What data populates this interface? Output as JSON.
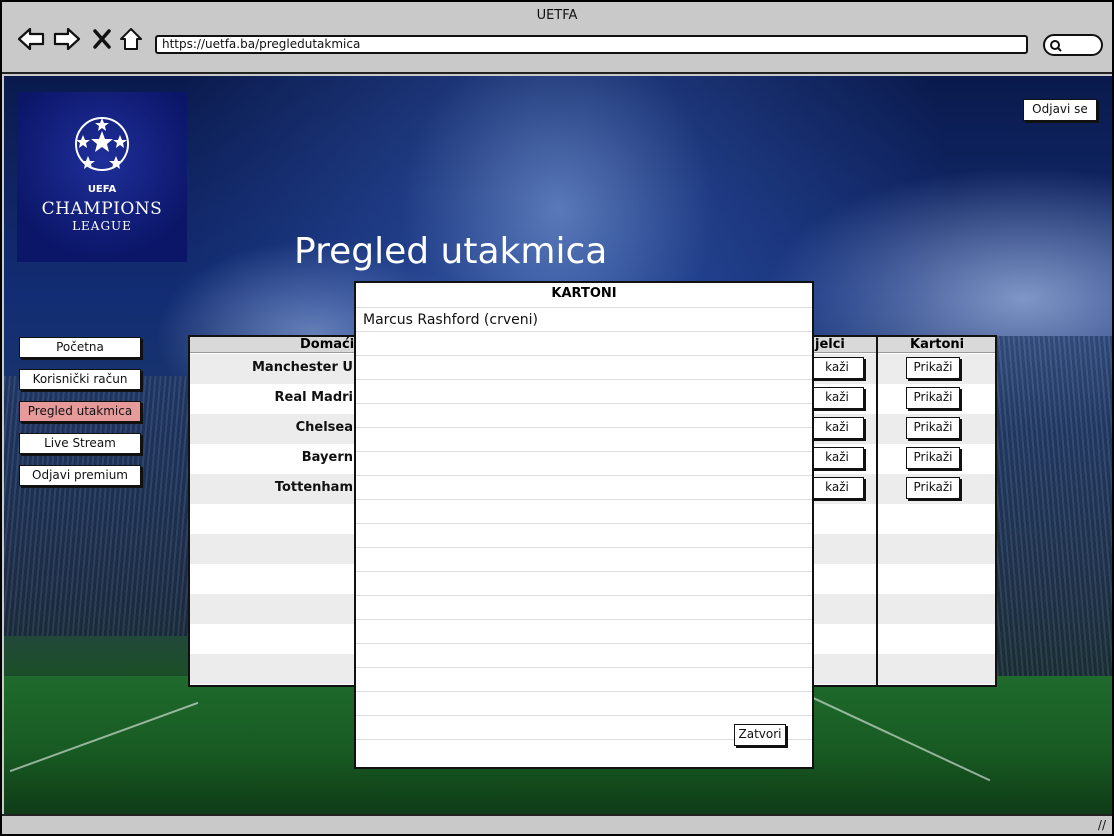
{
  "window": {
    "title": "UETFA"
  },
  "browser": {
    "url": "https://uetfa.ba/pregledutakmica"
  },
  "logo": {
    "uefa": "UEFA",
    "line1": "CHAMPIONS",
    "line2": "LEAGUE"
  },
  "header": {
    "logout_label": "Odjavi se",
    "page_title": "Pregled utakmica"
  },
  "sidebar": {
    "items": [
      {
        "label": "Početna"
      },
      {
        "label": "Korisnički račun"
      },
      {
        "label": "Pregled utakmica",
        "active": true
      },
      {
        "label": "Live Stream"
      },
      {
        "label": "Odjavi premium"
      }
    ]
  },
  "table": {
    "headers": {
      "home": "Domaći",
      "scorers": "jelci",
      "cards": "Kartoni"
    },
    "rows": [
      {
        "home": "Manchester U",
        "scorers_btn": "kaži",
        "cards_btn": "Prikaži"
      },
      {
        "home": "Real Madri",
        "scorers_btn": "kaži",
        "cards_btn": "Prikaži"
      },
      {
        "home": "Chelsea",
        "scorers_btn": "kaži",
        "cards_btn": "Prikaži"
      },
      {
        "home": "Bayern",
        "scorers_btn": "kaži",
        "cards_btn": "Prikaži"
      },
      {
        "home": "Tottenham",
        "scorers_btn": "kaži",
        "cards_btn": "Prikaži"
      }
    ]
  },
  "modal": {
    "title": "KARTONI",
    "items": [
      "Marcus Rashford (crveni)"
    ],
    "close_label": "Zatvori"
  },
  "colors": {
    "active_nav": "#e79a9a",
    "logo_bg": "#0b1668"
  }
}
